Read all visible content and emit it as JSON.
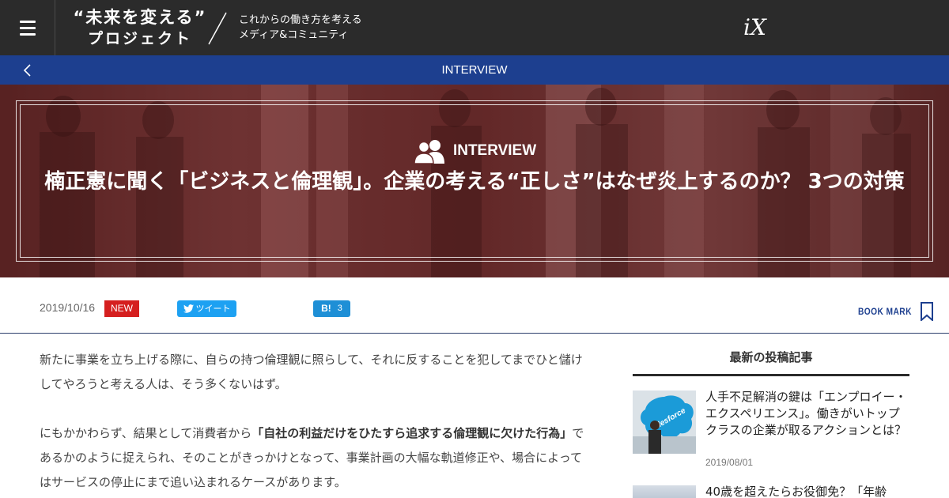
{
  "header": {
    "logo_line1": "“未来を変える”",
    "logo_line2": "プロジェクト",
    "tagline_line1": "これからの働き方を考える",
    "tagline_line2": "メディア&コミュニティ",
    "brand_mark": "iX"
  },
  "category_bar": {
    "label": "INTERVIEW"
  },
  "hero": {
    "kicker": "INTERVIEW",
    "title": "楠正憲に聞く「ビジネスと倫理観」。企業の考える“正しさ”はなぜ炎上するのか？ 3つの対策"
  },
  "meta": {
    "date": "2019/10/16",
    "new_badge": "NEW",
    "tweet_label": "ツイート",
    "hatena_label": "B!",
    "hatena_count": "3",
    "bookmark_label": "BOOK MARK"
  },
  "article": {
    "para1": "新たに事業を立ち上げる際に、自らの持つ倫理観に照らして、それに反することを犯してまでひと儲けしてやろうと考える人は、そう多くないはず。",
    "para2_before": "にもかかわらず、結果として消費者から",
    "para2_strong": "「自社の利益だけをひたすら追求する倫理観に欠けた行為」",
    "para2_after": "であるかのように捉えられ、そのことがきっかけとなって、事業計画の大幅な軌道修正や、場合によってはサービスの停止にまで追い込まれるケースがあります。"
  },
  "sidebar": {
    "heading": "最新の投稿記事",
    "items": [
      {
        "title": "人手不足解消の鍵は「エンプロイー・エクスペリエンス」。働きがいトップクラスの企業が取るアクションとは？",
        "date": "2019/08/01",
        "thumb_text": "salesforce"
      },
      {
        "title": "40歳を超えたらお役御免？「年齢"
      }
    ]
  },
  "colors": {
    "header_bg": "#2b2b2b",
    "category_bar_bg": "#1d3f8f",
    "new_badge": "#d51f1f",
    "twitter": "#1da1f2",
    "hatena": "#1e8fd6"
  }
}
